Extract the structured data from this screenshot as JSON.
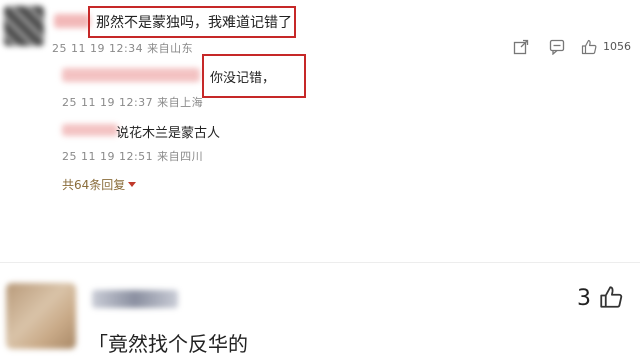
{
  "comment": {
    "text": "那然不是蒙独吗，我难道记错了",
    "meta": "25 11 19 12:34 来自山东",
    "like_count": "1056",
    "icons": [
      "share-icon",
      "comment-icon",
      "like-icon"
    ]
  },
  "replies": [
    {
      "text": "你没记错，",
      "meta": "25 11 19 12:37 来自上海"
    },
    {
      "text": "说花木兰是蒙古人",
      "meta": "25 11 19 12:51 来自四川"
    }
  ],
  "more_replies_label": "共64条回复",
  "next_comment": {
    "like_count": "3",
    "text": "「竟然找个反华的",
    "icons": [
      "like-icon"
    ]
  }
}
